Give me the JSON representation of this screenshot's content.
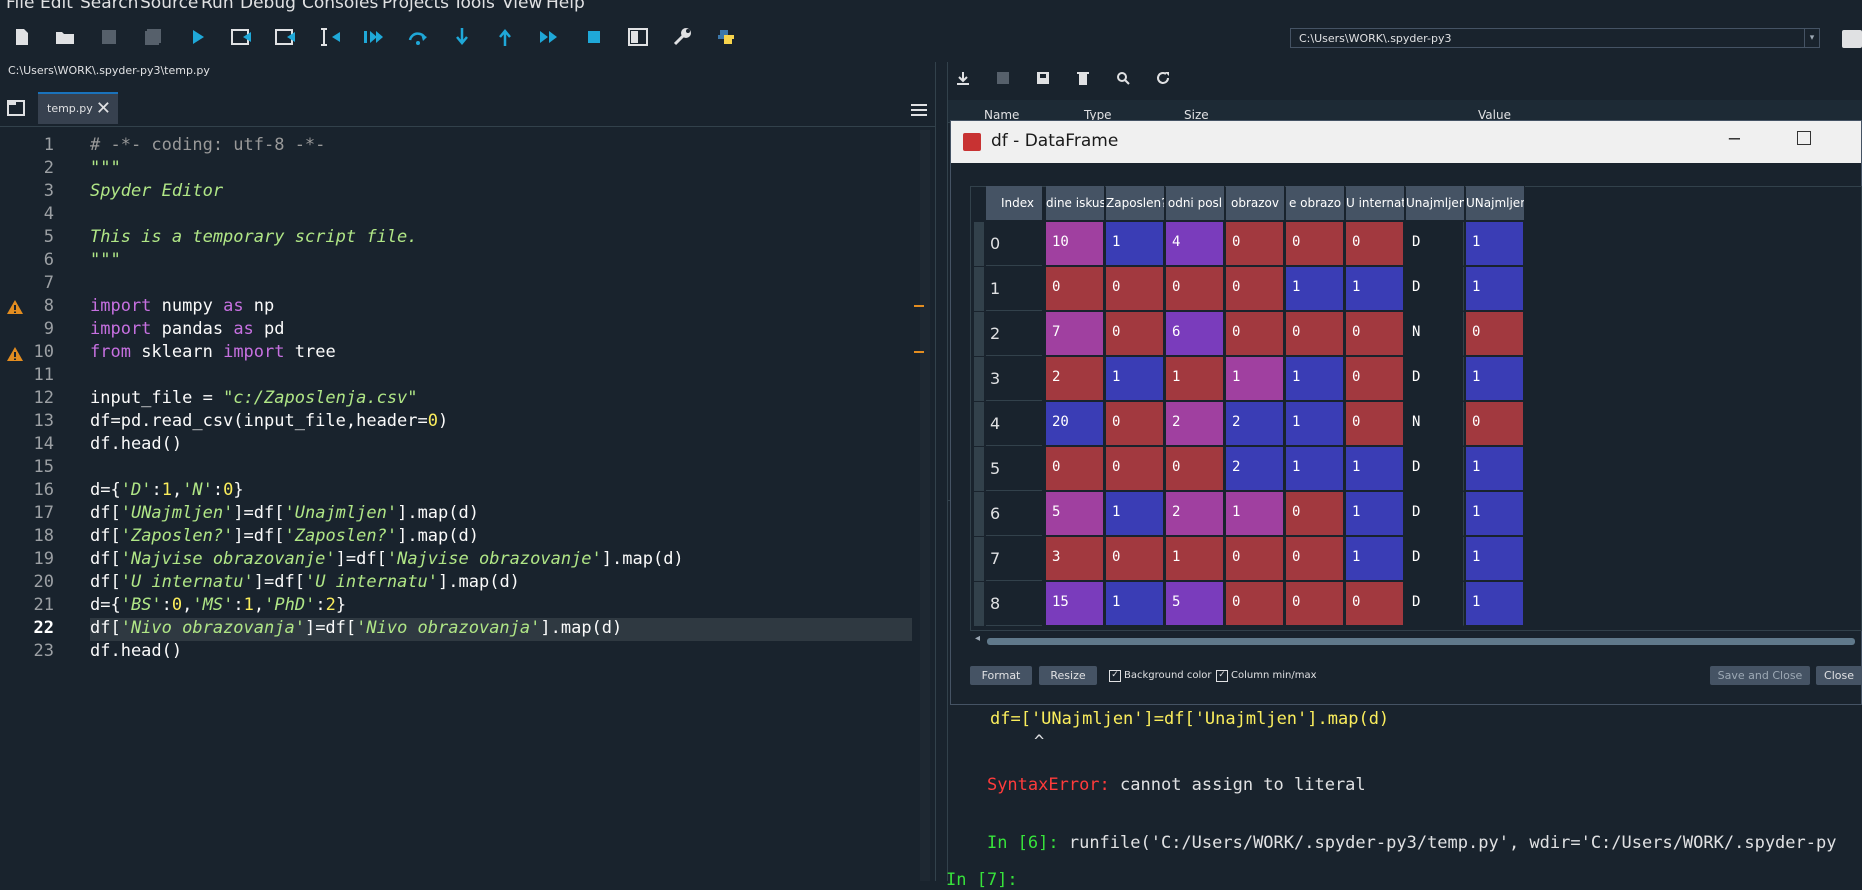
{
  "menu": [
    "File",
    "Edit",
    "Search",
    "Source",
    "Run",
    "Debug",
    "Consoles",
    "Projects",
    "Tools",
    "View",
    "Help"
  ],
  "toolbar": {
    "working_dir": "C:\\Users\\WORK\\.spyder-py3"
  },
  "editor": {
    "path": "C:\\Users\\WORK\\.spyder-py3\\temp.py",
    "tab_label": "temp.py",
    "line_numbers": [
      "1",
      "2",
      "3",
      "4",
      "5",
      "6",
      "7",
      "8",
      "9",
      "10",
      "11",
      "12",
      "13",
      "14",
      "15",
      "16",
      "17",
      "18",
      "19",
      "20",
      "21",
      "22",
      "23"
    ],
    "current_line": "22"
  },
  "variable_explorer": {
    "columns": [
      "Name",
      "Type",
      "Size",
      "Value"
    ]
  },
  "dialog": {
    "title": "df - DataFrame",
    "index_header": "Index",
    "headers": [
      "dine iskus",
      "Zaposlen?",
      "odni posl",
      "obrazov",
      "e obrazo",
      "U internat",
      "Unajmljen",
      "UNajmljen"
    ],
    "index": [
      "0",
      "1",
      "2",
      "3",
      "4",
      "5",
      "6",
      "7",
      "8"
    ],
    "rows": [
      [
        "10",
        "1",
        "4",
        "0",
        "0",
        "0",
        "D",
        "1"
      ],
      [
        "0",
        "0",
        "0",
        "0",
        "1",
        "1",
        "D",
        "1"
      ],
      [
        "7",
        "0",
        "6",
        "0",
        "0",
        "0",
        "N",
        "0"
      ],
      [
        "2",
        "1",
        "1",
        "1",
        "1",
        "0",
        "D",
        "1"
      ],
      [
        "20",
        "0",
        "2",
        "2",
        "1",
        "0",
        "N",
        "0"
      ],
      [
        "0",
        "0",
        "0",
        "2",
        "1",
        "1",
        "D",
        "1"
      ],
      [
        "5",
        "1",
        "2",
        "1",
        "0",
        "1",
        "D",
        "1"
      ],
      [
        "3",
        "0",
        "1",
        "0",
        "0",
        "1",
        "D",
        "1"
      ],
      [
        "15",
        "1",
        "5",
        "0",
        "0",
        "0",
        "D",
        "1"
      ]
    ],
    "format_button": "Format",
    "resize_button": "Resize",
    "background_color_label": "Background color",
    "column_minmax_label": "Column min/max",
    "save_close_button": "Save and Close",
    "close_button": "Close"
  },
  "console": {
    "error_code_line": "df=['UNajmljen']=df['Unajmljen'].map(d)",
    "caret": "^",
    "error_type": "SyntaxError:",
    "error_msg": " cannot assign to literal",
    "prompt_in6": "In [6]:",
    "runfile_cmd": " runfile('C:/Users/WORK/.spyder-py3/temp.py', wdir='C:/Users/WORK/.spyder-py",
    "prompt_in7": "In [7]:"
  },
  "colors": {
    "background": "#19232d",
    "cell_red": "#a2393f",
    "cell_blue": "#3a3db5",
    "cell_purple": "#a040a0",
    "cell_violet": "#7a3cbc"
  }
}
